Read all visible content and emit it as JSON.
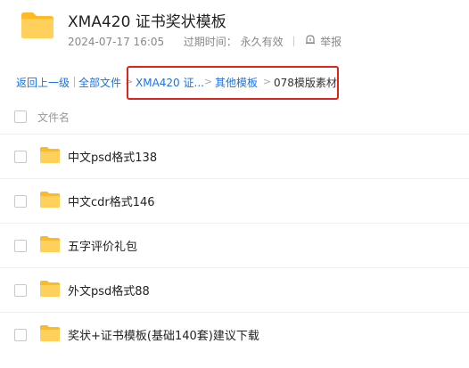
{
  "header": {
    "title": "XMA420 证书奖状模板",
    "date": "2024-07-17 16:05",
    "expire_label": "过期时间：",
    "expire_value": "永久有效",
    "report_label": "举报"
  },
  "breadcrumb": {
    "back": "返回上一级",
    "all_files": "全部文件",
    "items": [
      "XMA420 证...",
      "其他模板"
    ],
    "current": "078模版素材",
    "separator": ">"
  },
  "list": {
    "column_header": "文件名",
    "rows": [
      {
        "name": "中文psd格式138"
      },
      {
        "name": "中文cdr格式146"
      },
      {
        "name": "五字评价礼包"
      },
      {
        "name": "外文psd格式88"
      },
      {
        "name": "奖状+证书模板(基础140套)建议下载"
      }
    ]
  },
  "colors": {
    "link": "#1a73e8",
    "folder": "#ffc53d",
    "highlight_border": "#e0241c"
  },
  "icons": {
    "folder": "folder-icon",
    "report": "report-icon",
    "separator": "chevron-right-icon"
  }
}
